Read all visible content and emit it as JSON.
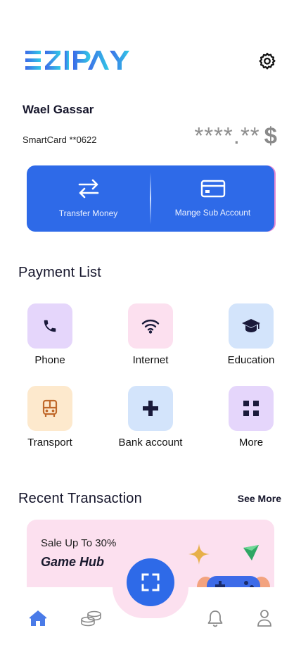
{
  "brand": {
    "name": "EZIPAY",
    "gradient_start": "#3d6be8",
    "gradient_end": "#31c9e6"
  },
  "header": {
    "settings_icon": "gear-icon"
  },
  "account": {
    "user_name": "Wael Gassar",
    "card_label": "SmartCard **0622",
    "balance_masked": "****.**",
    "currency": "$"
  },
  "actions": [
    {
      "label": "Transfer Money",
      "icon": "transfer-arrows-icon"
    },
    {
      "label": "Mange Sub Account",
      "icon": "card-icon"
    }
  ],
  "payment_list": {
    "title": "Payment List",
    "items": [
      {
        "label": "Phone",
        "icon": "phone-icon",
        "bg": "#e5d6fb"
      },
      {
        "label": "Internet",
        "icon": "wifi-icon",
        "bg": "#fce0ef"
      },
      {
        "label": "Education",
        "icon": "graduation-cap-icon",
        "bg": "#d3e4fb"
      },
      {
        "label": "Transport",
        "icon": "bus-icon",
        "bg": "#fde9cd"
      },
      {
        "label": "Bank account",
        "icon": "plus-icon",
        "bg": "#d3e4fb"
      },
      {
        "label": "More",
        "icon": "grid-icon",
        "bg": "#e5d6fb"
      }
    ]
  },
  "recent": {
    "title": "Recent Transaction",
    "see_more": "See More"
  },
  "promo": {
    "line1": "Sale Up To 30%",
    "line2": "Game Hub"
  },
  "colors": {
    "accent": "#2e6ae8",
    "text_dark": "#15152b",
    "nav_active": "#4a7be8",
    "nav_inactive": "#8a8a8a"
  },
  "nav": [
    {
      "name": "home",
      "icon": "home-icon",
      "active": true
    },
    {
      "name": "coins",
      "icon": "coins-icon",
      "active": false
    },
    {
      "name": "scan",
      "icon": "scan-icon",
      "active": false
    },
    {
      "name": "notifications",
      "icon": "bell-icon",
      "active": false
    },
    {
      "name": "profile",
      "icon": "user-icon",
      "active": false
    }
  ]
}
